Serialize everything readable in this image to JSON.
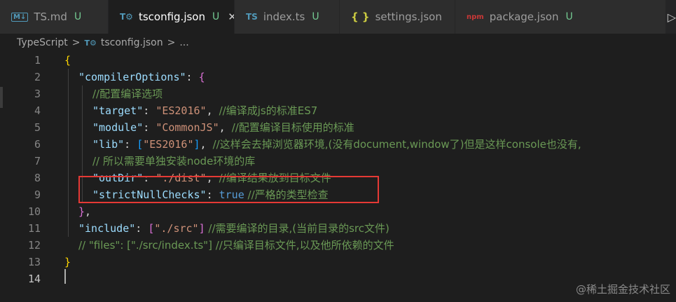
{
  "tabs": [
    {
      "icon": "M↓",
      "label": "TS.md",
      "status": "U"
    },
    {
      "icon": "T⚙",
      "label": "tsconfig.json",
      "status": "U",
      "close": "✕"
    },
    {
      "icon": "TS",
      "label": "index.ts",
      "status": "U"
    },
    {
      "icon": "{ }",
      "label": "settings.json",
      "status": ""
    },
    {
      "icon": "npm",
      "label": "package.json",
      "status": "U"
    }
  ],
  "tab_tools_icon": "▷",
  "breadcrumb": {
    "folder": "TypeScript",
    "file_icon": "T⚙",
    "file": "tsconfig.json",
    "more": "...",
    "separator": ">"
  },
  "line_numbers": [
    "1",
    "2",
    "3",
    "4",
    "5",
    "6",
    "7",
    "8",
    "9",
    "10",
    "11",
    "12",
    "13",
    "14"
  ],
  "code": {
    "l1": {
      "brace": "{"
    },
    "l2": {
      "key": "\"compilerOptions\"",
      "colon": ": ",
      "brace": "{"
    },
    "l3": {
      "comment": "//配置编译选项"
    },
    "l4": {
      "key": "\"target\"",
      "colon": ": ",
      "value": "\"ES2016\"",
      "comma": ", ",
      "comment": "//编译成js的标准ES7"
    },
    "l5": {
      "key": "\"module\"",
      "colon": ": ",
      "value": "\"CommonJS\"",
      "comma": ", ",
      "comment": "//配置编译目标使用的标准"
    },
    "l6": {
      "key": "\"lib\"",
      "colon": ": ",
      "open": "[",
      "value": "\"ES2016\"",
      "close": "]",
      "comma": ", ",
      "comment": "//这样会去掉浏览器环境,(没有document,window了)但是这样console也没有,"
    },
    "l7": {
      "comment": "// 所以需要单独安装node环境的库"
    },
    "l8": {
      "key": "\"outDir\"",
      "colon": ": ",
      "value": "\"./dist\"",
      "comma": ", ",
      "comment": "//编译结果放到目标文件"
    },
    "l9": {
      "key": "\"strictNullChecks\"",
      "colon": ": ",
      "value": "true",
      "comment": " //严格的类型检查"
    },
    "l10": {
      "brace": "}",
      "comma": ","
    },
    "l11": {
      "key": "\"include\"",
      "colon": ": ",
      "open": "[",
      "value": "\"./src\"",
      "close": "]",
      "comment": " //需要编译的目录,(当前目录的src文件)"
    },
    "l12": {
      "comment": "// \"files\": [\"./src/index.ts\"] //只编译目标文件,以及他所依赖的文件"
    },
    "l13": {
      "brace": "}"
    }
  },
  "watermark": "@稀土掘金技术社区",
  "colors": {
    "key": "#9cdcfe",
    "string": "#ce9178",
    "keyword": "#569cd6",
    "comment": "#6a9955",
    "highlight_box": "#e53935"
  }
}
